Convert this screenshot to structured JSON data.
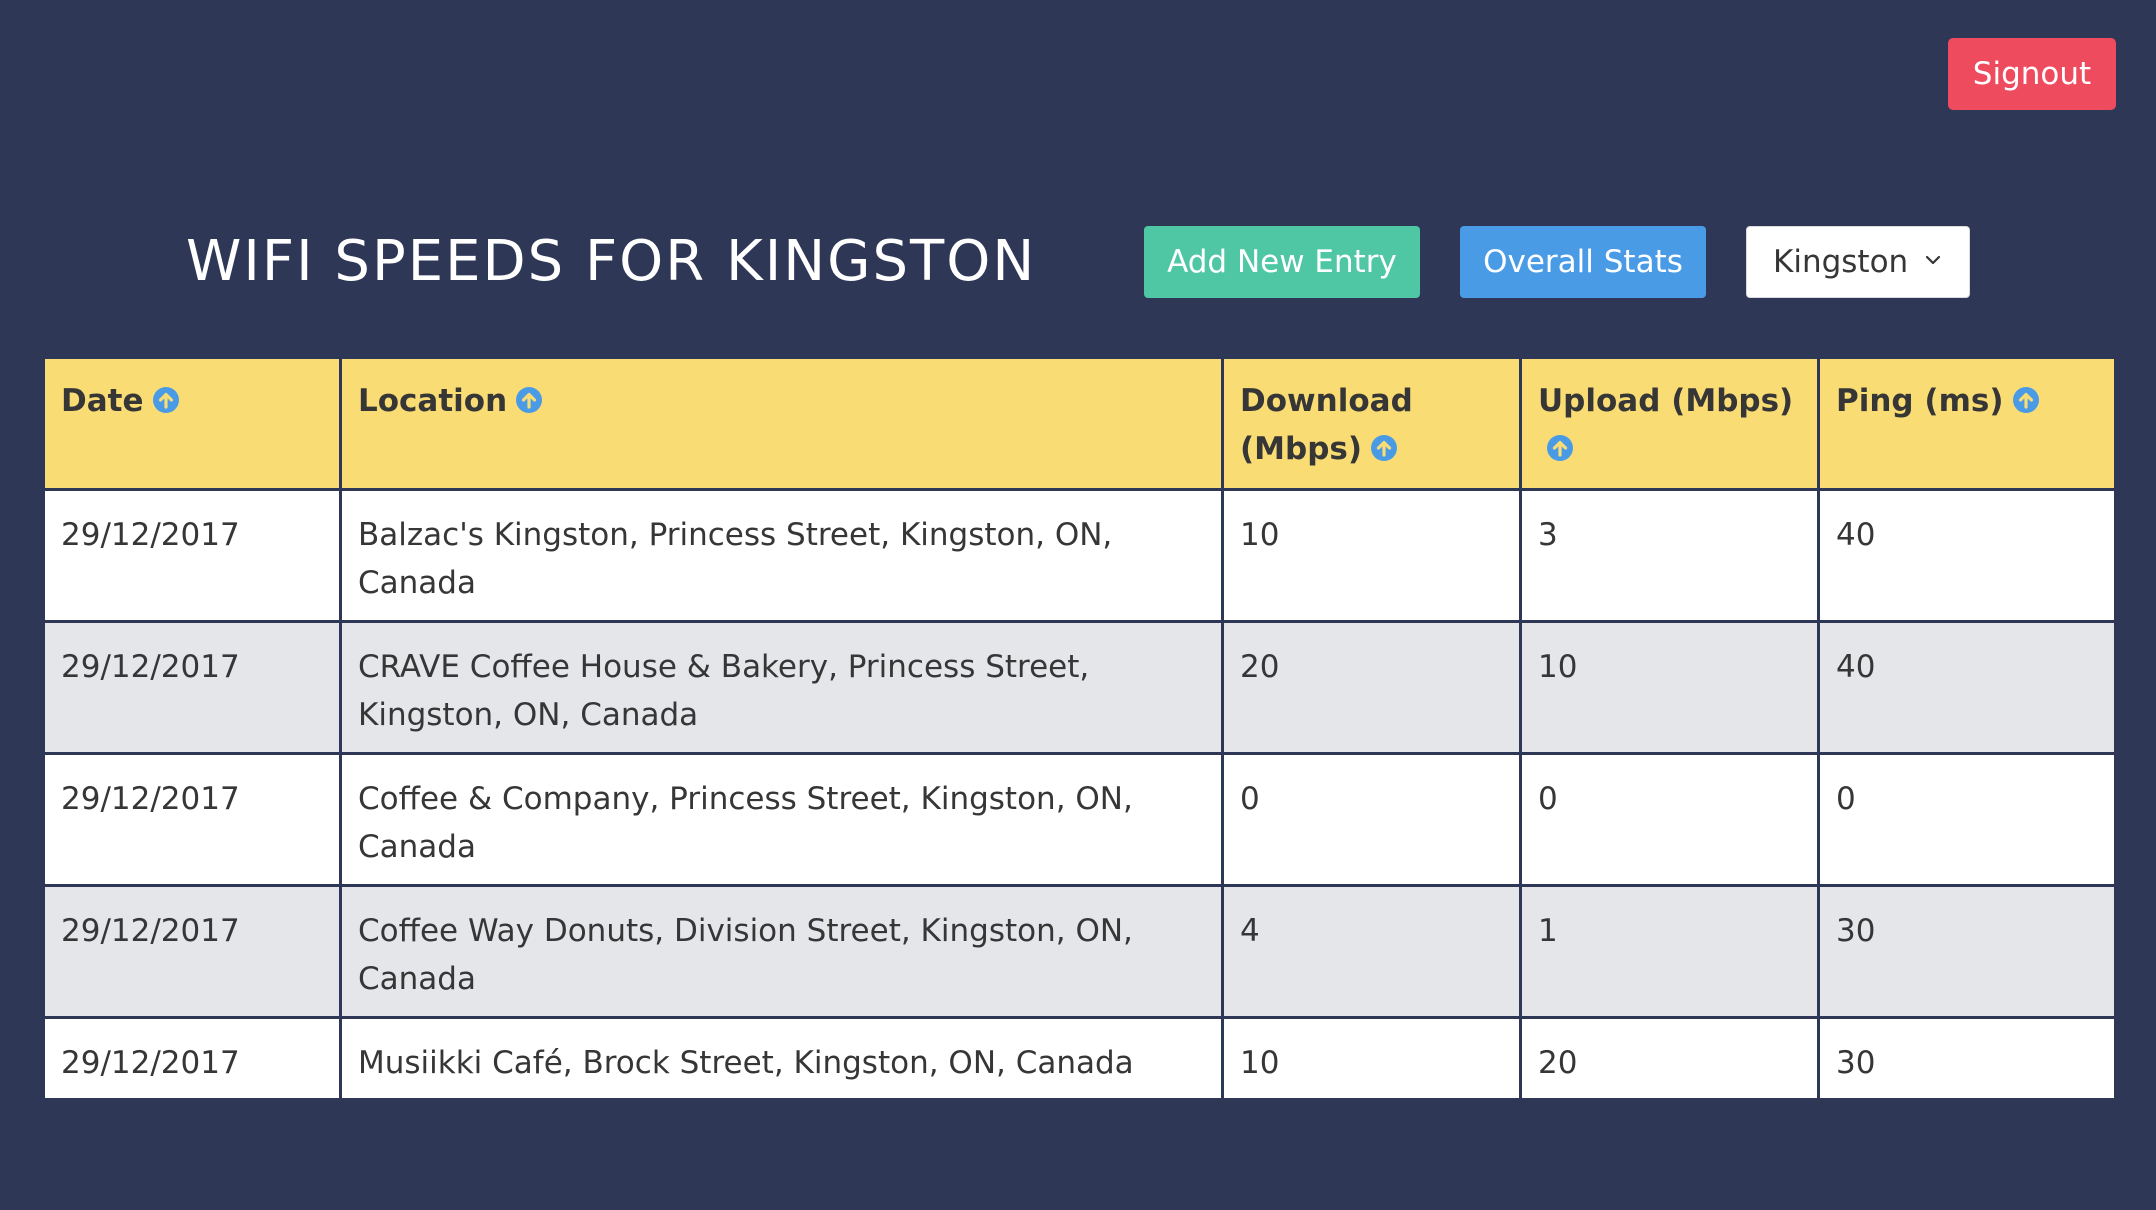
{
  "header": {
    "signout_label": "Signout",
    "title": "WIFI SPEEDS FOR KINGSTON",
    "add_label": "Add New Entry",
    "stats_label": "Overall Stats",
    "city_select": "Kingston"
  },
  "colors": {
    "background": "#2f3757",
    "signout": "#ef4b5f",
    "add": "#4fc7a4",
    "stats": "#4a9be6",
    "table_header": "#f9dc74",
    "sort_icon": "#4a9be6",
    "row_stripe": "#e5e6ea"
  },
  "icons": {
    "sort": "arrow-up-circle-icon",
    "select": "chevron-down-icon"
  },
  "table": {
    "columns": [
      "Date",
      "Location",
      "Download (Mbps)",
      "Upload (Mbps)",
      "Ping (ms)"
    ],
    "rows": [
      [
        "29/12/2017",
        "Balzac's Kingston, Princess Street, Kingston, ON, Canada",
        "10",
        "3",
        "40"
      ],
      [
        "29/12/2017",
        "CRAVE Coffee House & Bakery, Princess Street, Kingston, ON, Canada",
        "20",
        "10",
        "40"
      ],
      [
        "29/12/2017",
        "Coffee & Company, Princess Street, Kingston, ON, Canada",
        "0",
        "0",
        "0"
      ],
      [
        "29/12/2017",
        "Coffee Way Donuts, Division Street, Kingston, ON, Canada",
        "4",
        "1",
        "30"
      ],
      [
        "29/12/2017",
        "Musiikki Café, Brock Street, Kingston, ON, Canada",
        "10",
        "20",
        "30"
      ]
    ]
  }
}
